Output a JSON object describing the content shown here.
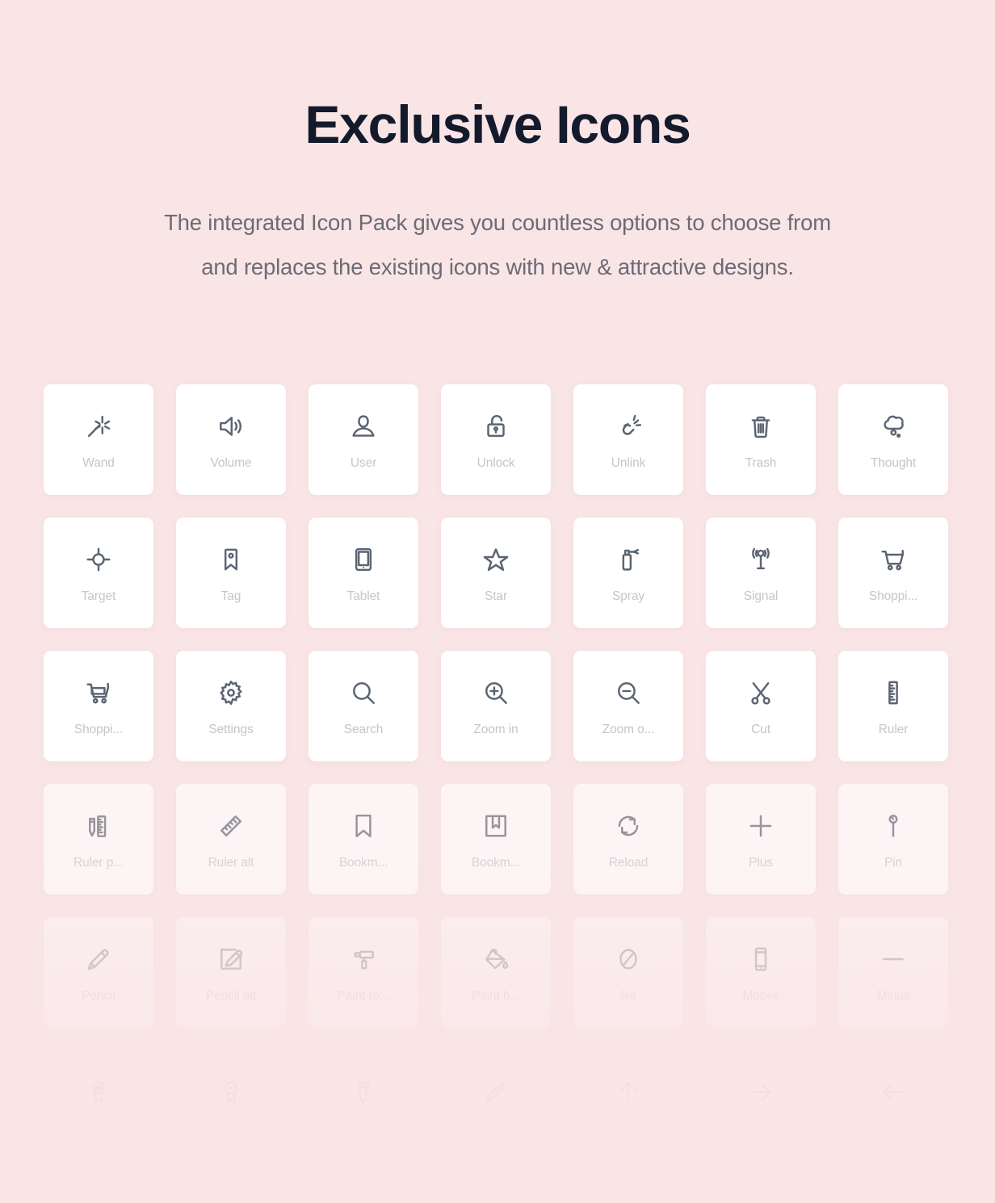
{
  "header": {
    "title": "Exclusive Icons",
    "subtitle_line_1": "The integrated Icon Pack gives you countless options to choose from",
    "subtitle_line_2": "and replaces the existing icons with new & attractive designs."
  },
  "colors": {
    "background": "#fae5e6",
    "card_background": "#ffffff",
    "title_text": "#131a2b",
    "subtitle_text": "#6b6b76",
    "label_text": "#c9c3ca",
    "icon_stroke": "#5b6472"
  },
  "grid": {
    "columns": 7,
    "rows": 6,
    "items": [
      {
        "label": "Wand",
        "icon": "wand-icon",
        "row": 1
      },
      {
        "label": "Volume",
        "icon": "volume-icon",
        "row": 1
      },
      {
        "label": "User",
        "icon": "user-icon",
        "row": 1
      },
      {
        "label": "Unlock",
        "icon": "unlock-icon",
        "row": 1
      },
      {
        "label": "Unlink",
        "icon": "unlink-icon",
        "row": 1
      },
      {
        "label": "Trash",
        "icon": "trash-icon",
        "row": 1
      },
      {
        "label": "Thought",
        "icon": "thought-icon",
        "row": 1
      },
      {
        "label": "Target",
        "icon": "target-icon",
        "row": 2
      },
      {
        "label": "Tag",
        "icon": "tag-icon",
        "row": 2
      },
      {
        "label": "Tablet",
        "icon": "tablet-icon",
        "row": 2
      },
      {
        "label": "Star",
        "icon": "star-icon",
        "row": 2
      },
      {
        "label": "Spray",
        "icon": "spray-icon",
        "row": 2
      },
      {
        "label": "Signal",
        "icon": "signal-icon",
        "row": 2
      },
      {
        "label": "Shoppi...",
        "icon": "shopping-cart-icon",
        "row": 2
      },
      {
        "label": "Shoppi...",
        "icon": "shopping-cart-alt-icon",
        "row": 3
      },
      {
        "label": "Settings",
        "icon": "settings-icon",
        "row": 3
      },
      {
        "label": "Search",
        "icon": "search-icon",
        "row": 3
      },
      {
        "label": "Zoom in",
        "icon": "zoom-in-icon",
        "row": 3
      },
      {
        "label": "Zoom o...",
        "icon": "zoom-out-icon",
        "row": 3
      },
      {
        "label": "Cut",
        "icon": "cut-icon",
        "row": 3
      },
      {
        "label": "Ruler",
        "icon": "ruler-icon",
        "row": 3
      },
      {
        "label": "Ruler p...",
        "icon": "ruler-pencil-icon",
        "row": 4
      },
      {
        "label": "Ruler alt",
        "icon": "ruler-alt-icon",
        "row": 4
      },
      {
        "label": "Bookm...",
        "icon": "bookmark-icon",
        "row": 4
      },
      {
        "label": "Bookm...",
        "icon": "bookmark-alt-icon",
        "row": 4
      },
      {
        "label": "Reload",
        "icon": "reload-icon",
        "row": 4
      },
      {
        "label": "Plus",
        "icon": "plus-icon",
        "row": 4
      },
      {
        "label": "Pin",
        "icon": "pin-icon",
        "row": 4
      },
      {
        "label": "Pencil",
        "icon": "pencil-icon",
        "row": 5
      },
      {
        "label": "Pencil alt",
        "icon": "pencil-alt-icon",
        "row": 5
      },
      {
        "label": "Paint ro...",
        "icon": "paint-roller-icon",
        "row": 5
      },
      {
        "label": "Paint b...",
        "icon": "paint-bucket-icon",
        "row": 5
      },
      {
        "label": "Na",
        "icon": "na-icon",
        "row": 5
      },
      {
        "label": "Mobile",
        "icon": "mobile-icon",
        "row": 5
      },
      {
        "label": "Minus",
        "icon": "minus-icon",
        "row": 5
      },
      {
        "label": "Medall",
        "icon": "medal-icon",
        "row": 6
      },
      {
        "label": "Medall ...",
        "icon": "medal-alt-icon",
        "row": 6
      },
      {
        "label": "Marker",
        "icon": "marker-icon",
        "row": 6
      },
      {
        "label": "Marker ...",
        "icon": "marker-alt-icon",
        "row": 6
      },
      {
        "label": "Arrow up",
        "icon": "arrow-up-icon",
        "row": 6
      },
      {
        "label": "Arrow ri...",
        "icon": "arrow-right-icon",
        "row": 6
      },
      {
        "label": "Arrow l...",
        "icon": "arrow-left-icon",
        "row": 6
      }
    ]
  }
}
